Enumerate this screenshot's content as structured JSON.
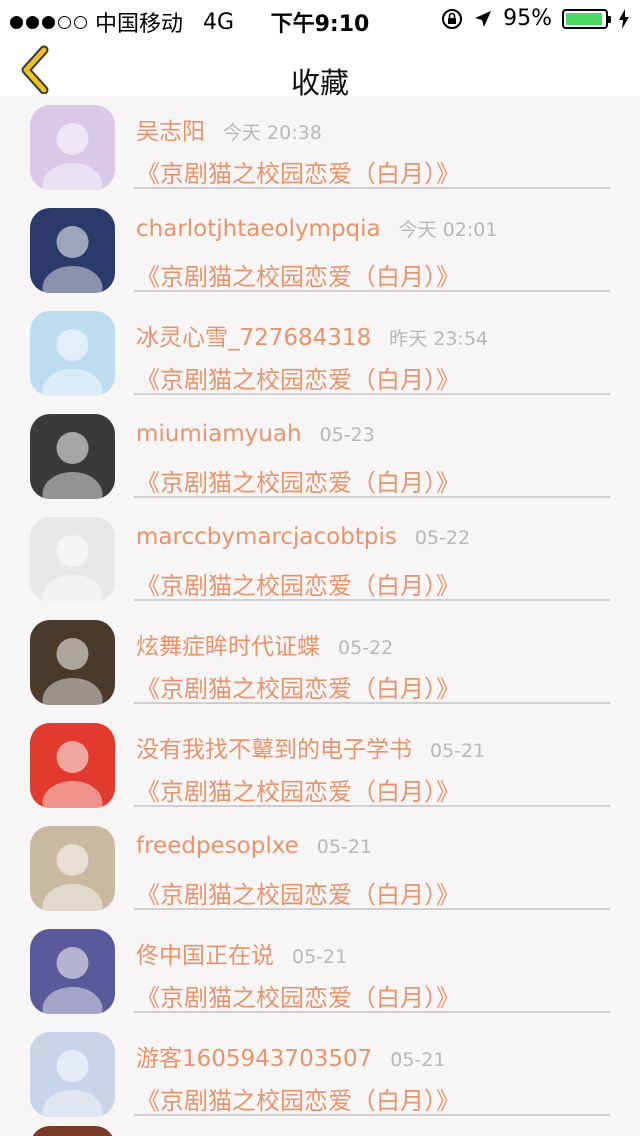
{
  "status": {
    "carrier": "中国移动",
    "network": "4G",
    "time": "下午9:10",
    "battery": "95%",
    "battery_level": 0.95
  },
  "nav": {
    "title": "收藏"
  },
  "items": [
    {
      "name": "吴志阳",
      "time": "今天 20:38",
      "work": "《京剧猫之校园恋爱（白月）》",
      "avatar_color": "#d9c8e8"
    },
    {
      "name": "charlotjhtaeolympqia",
      "time": "今天 02:01",
      "work": "《京剧猫之校园恋爱（白月）》",
      "avatar_color": "#2b3a6b"
    },
    {
      "name": "冰灵心雪_727684318",
      "time": "昨天 23:54",
      "work": "《京剧猫之校园恋爱（白月）》",
      "avatar_color": "#bcdcf0"
    },
    {
      "name": "miumiamyuah",
      "time": "05-23",
      "work": "《京剧猫之校园恋爱（白月）》",
      "avatar_color": "#3a3a3a"
    },
    {
      "name": "marccbymarcjacobtpis",
      "time": "05-22",
      "work": "《京剧猫之校园恋爱（白月）》",
      "avatar_color": "#e8e8e8"
    },
    {
      "name": "炫舞症眸时代证蝶",
      "time": "05-22",
      "work": "《京剧猫之校园恋爱（白月）》",
      "avatar_color": "#4a3a2c"
    },
    {
      "name": "没有我找不鼙到的电子学书",
      "time": "05-21",
      "work": "《京剧猫之校园恋爱（白月）》",
      "avatar_color": "#e23a2e"
    },
    {
      "name": "freedpesoplxe",
      "time": "05-21",
      "work": "《京剧猫之校园恋爱（白月）》",
      "avatar_color": "#c9b9a0"
    },
    {
      "name": "佟中国正在说",
      "time": "05-21",
      "work": "《京剧猫之校园恋爱（白月）》",
      "avatar_color": "#5a5a9a"
    },
    {
      "name": "游客1605943703507",
      "time": "05-21",
      "work": "《京剧猫之校园恋爱（白月）》",
      "avatar_color": "#c8d4e8"
    }
  ],
  "colors": {
    "accent": "#e8946a",
    "back_arrow": "#f0c020",
    "time_text": "#b8b8b8",
    "background": "#f7f5f6"
  }
}
